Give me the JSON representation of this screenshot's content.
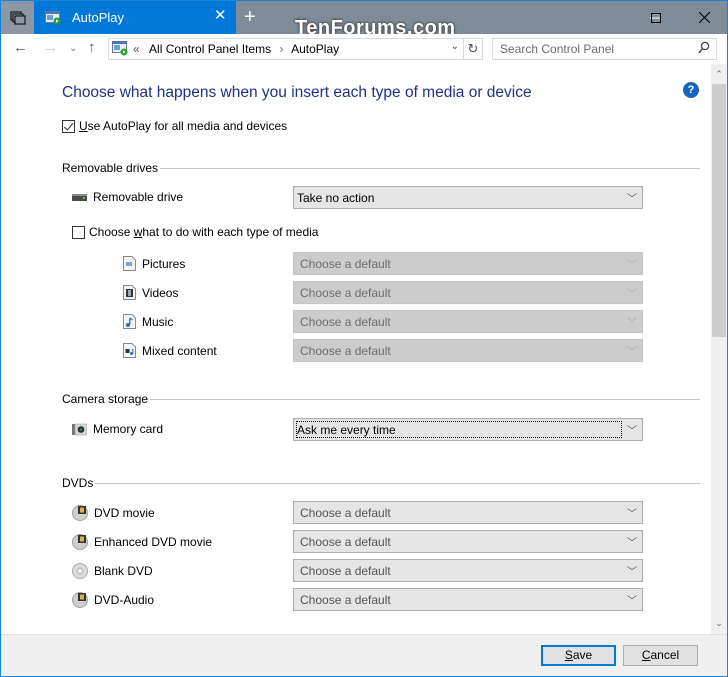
{
  "window": {
    "tab_title": "AutoPlay",
    "new_tab": "+",
    "watermark": "TenForums.com",
    "controls": {
      "minimize": "—",
      "maximize": "☐",
      "close": "✕"
    }
  },
  "nav": {
    "back": "←",
    "forward": "→",
    "recent": "⌄",
    "up": "↑",
    "address_prefix": "«",
    "breadcrumb": [
      "All Control Panel Items",
      "AutoPlay"
    ],
    "breadcrumb_sep": "›",
    "address_dropdown": "⌄",
    "refresh": "↻",
    "search_placeholder": "Search Control Panel"
  },
  "main": {
    "title": "Choose what happens when you insert each type of media or device",
    "help": "?",
    "use_autoplay": {
      "label_u": "U",
      "label_rest": "se AutoPlay for all media and devices",
      "checked": true
    },
    "sections": {
      "removable": {
        "label": "Removable drives",
        "drive": {
          "label": "Removable drive",
          "icon": "drive-icon",
          "value": "Take no action"
        },
        "per_media": {
          "label_pre": "Choose ",
          "label_u": "w",
          "label_rest": "hat to do with each type of media",
          "checked": false
        },
        "media": [
          {
            "label": "Pictures",
            "icon": "pictures-icon",
            "value": "Choose a default",
            "disabled": true
          },
          {
            "label": "Videos",
            "icon": "videos-icon",
            "value": "Choose a default",
            "disabled": true
          },
          {
            "label": "Music",
            "icon": "music-icon",
            "value": "Choose a default",
            "disabled": true
          },
          {
            "label": "Mixed content",
            "icon": "mixed-content-icon",
            "value": "Choose a default",
            "disabled": true
          }
        ]
      },
      "camera": {
        "label": "Camera storage",
        "memory_card": {
          "label": "Memory card",
          "icon": "memory-card-icon",
          "value": "Ask me every time"
        }
      },
      "dvds": {
        "label": "DVDs",
        "items": [
          {
            "label": "DVD movie",
            "icon": "dvd-movie-icon",
            "value": "Choose a default"
          },
          {
            "label": "Enhanced DVD movie",
            "icon": "dvd-movie-icon",
            "value": "Choose a default"
          },
          {
            "label": "Blank DVD",
            "icon": "blank-dvd-icon",
            "value": "Choose a default"
          },
          {
            "label": "DVD-Audio",
            "icon": "dvd-movie-icon",
            "value": "Choose a default"
          }
        ]
      }
    }
  },
  "footer": {
    "save_u": "S",
    "save_rest": "ave",
    "cancel_u": "C",
    "cancel_rest": "ancel"
  },
  "scrollbar": {
    "up": "⌃",
    "down": "⌄",
    "position_fraction": 0.0
  }
}
